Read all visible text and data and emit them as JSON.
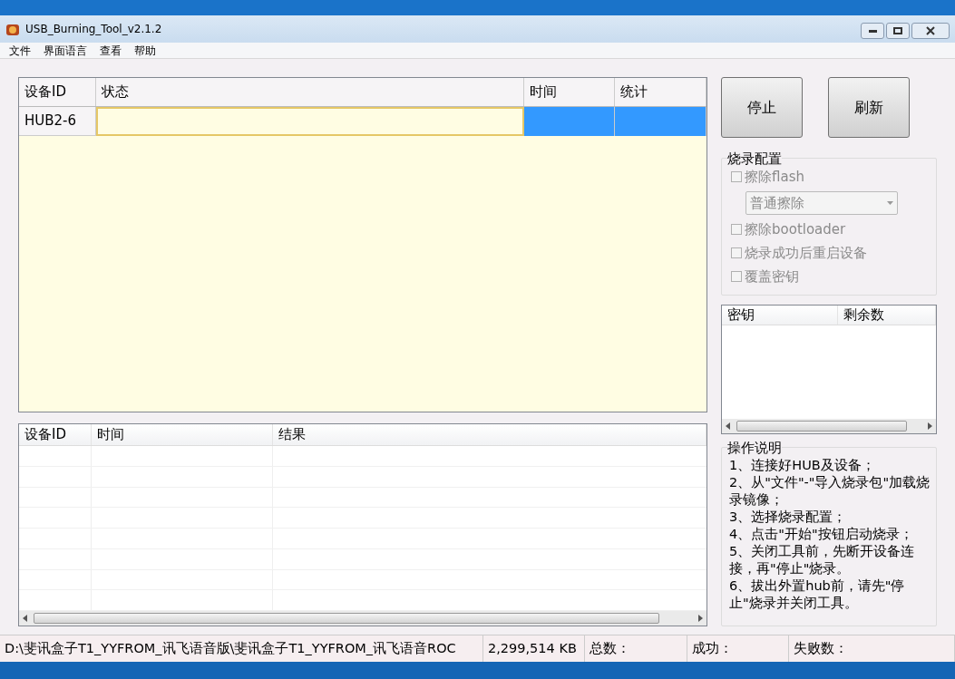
{
  "window": {
    "title": "USB_Burning_Tool_v2.1.2"
  },
  "menu": [
    "文件",
    "界面语言",
    "查看",
    "帮助"
  ],
  "device_table": {
    "columns": [
      "设备ID",
      "状态",
      "时间",
      "统计"
    ],
    "rows": [
      {
        "device_id": "HUB2-6",
        "selected": true
      }
    ]
  },
  "result_table": {
    "columns": [
      "设备ID",
      "时间",
      "结果"
    ]
  },
  "buttons": [
    "停止",
    "刷新"
  ],
  "burn_config": {
    "title": "烧录配置",
    "options": [
      {
        "kind": "checkbox",
        "label": "擦除flash",
        "checked": false,
        "disabled": true
      },
      {
        "kind": "dropdown",
        "value": "普通擦除",
        "disabled": true
      },
      {
        "kind": "checkbox",
        "label": "擦除bootloader",
        "checked": false,
        "disabled": true
      },
      {
        "kind": "checkbox",
        "label": "烧录成功后重启设备",
        "checked": false,
        "disabled": true
      },
      {
        "kind": "checkbox",
        "label": "覆盖密钥",
        "checked": false,
        "disabled": true
      }
    ]
  },
  "key_table": {
    "columns": [
      "密钥",
      "剩余数"
    ]
  },
  "instructions": {
    "title": "操作说明",
    "steps": [
      "1、连接好HUB及设备；",
      "2、从\"文件\"-\"导入烧录包\"加载烧录镜像；",
      "3、选择烧录配置；",
      "4、点击\"开始\"按钮启动烧录；",
      "5、关闭工具前，先断开设备连接，再\"停止\"烧录。",
      "6、拔出外置hub前，请先\"停止\"烧录并关闭工具。"
    ]
  },
  "status_bar": [
    "D:\\斐讯盒子T1_YYFROM_讯飞语音版\\斐讯盒子T1_YYFROM_讯飞语音ROC",
    "2,299,514 KB",
    "总数：",
    "成功：",
    "失败数："
  ]
}
